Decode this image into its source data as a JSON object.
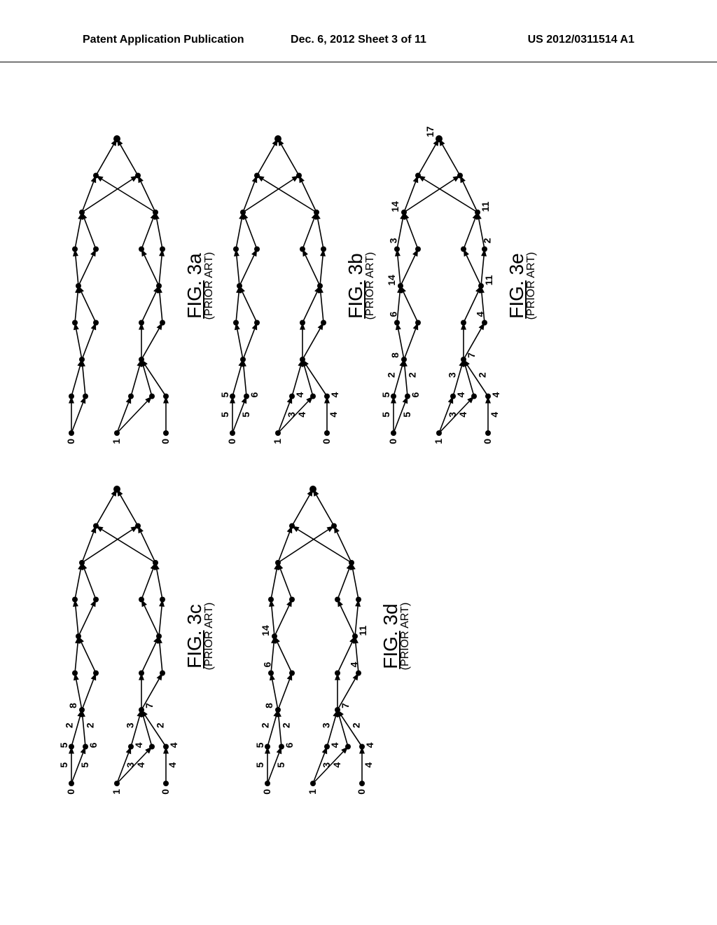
{
  "header": {
    "left": "Patent Application Publication",
    "center": "Dec. 6, 2012  Sheet 3 of 11",
    "right": "US 2012/0311514 A1"
  },
  "figures": {
    "a": {
      "label_prefix": "FIG.",
      "label_num": "3a",
      "prior": "(PRIOR ART)"
    },
    "b": {
      "label_prefix": "FIG.",
      "label_num": "3b",
      "prior": "(PRIOR ART)"
    },
    "c": {
      "label_prefix": "FIG.",
      "label_num": "3c",
      "prior": "(PRIOR ART)"
    },
    "d": {
      "label_prefix": "FIG.",
      "label_num": "3d",
      "prior": "(PRIOR ART)"
    },
    "e": {
      "label_prefix": "FIG.",
      "label_num": "3e",
      "prior": "(PRIOR ART)"
    }
  },
  "tree": {
    "startLabels": [
      "0",
      "1",
      "0"
    ],
    "stage1_tops": [
      "5",
      "6",
      "4",
      "4"
    ],
    "stage1_edges": [
      "5",
      "5",
      "3",
      "4",
      "4"
    ],
    "stage2_tops": [
      "2",
      "2",
      "3",
      "2"
    ],
    "stage2_nodes": [
      "8",
      "7"
    ],
    "stage3_edges": [
      "6",
      "4"
    ],
    "stage3_nodes": [
      "14",
      "11"
    ],
    "stage4_edges": [
      "3",
      "2"
    ],
    "stage4_node": "17"
  }
}
